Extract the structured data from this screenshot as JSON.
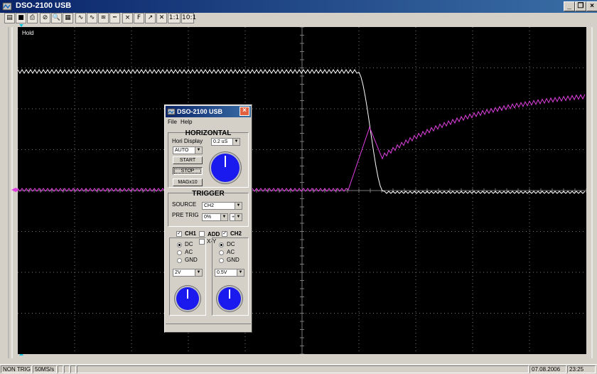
{
  "window": {
    "title": "DSO-2100 USB"
  },
  "toolbar": {
    "items": [
      {
        "name": "open-icon",
        "glyph": "▤"
      },
      {
        "name": "save-icon",
        "glyph": "■"
      },
      {
        "name": "print-icon",
        "glyph": "⎙"
      },
      {
        "name": "stop-sign-icon",
        "glyph": "⊘"
      },
      {
        "name": "zoom-icon",
        "glyph": "🔍"
      },
      {
        "name": "grid-icon",
        "glyph": "▦"
      },
      {
        "name": "sine-wave-icon",
        "glyph": "∿"
      },
      {
        "name": "wave-icon",
        "glyph": "∿"
      },
      {
        "name": "math-wave-icon",
        "glyph": "≋"
      },
      {
        "name": "dashed-lines-icon",
        "glyph": "┅"
      },
      {
        "name": "cursor-icon",
        "glyph": "×"
      },
      {
        "name": "fft-icon",
        "glyph": "F"
      },
      {
        "name": "measure-icon",
        "glyph": "↗"
      },
      {
        "name": "xy-icon",
        "glyph": "✕"
      },
      {
        "name": "ratio-1-1-icon",
        "glyph": "1:1"
      },
      {
        "name": "ratio-10-1-icon",
        "glyph": "10:1"
      }
    ]
  },
  "scope": {
    "hold_label": "Hold"
  },
  "statusbar": {
    "trigger_status": "NON TRIG",
    "sample_rate": "50MS/s",
    "date": "07.08.2006",
    "time": "23:25"
  },
  "panel": {
    "title": "DSO-2100 USB",
    "menu": [
      "File",
      "Help"
    ],
    "horizontal": {
      "title": "HORIZONTAL",
      "hori_display_label": "Hori Display",
      "timebase_value": "0.2 uS",
      "mode_value": "AUTO",
      "start_label": "START",
      "stop_label": "STOP",
      "mag_label": "MAGx10"
    },
    "trigger": {
      "title": "TRIGGER",
      "source_label": "SOURCE",
      "source_value": "CH2",
      "pretrig_label": "PRE TRIG",
      "pretrig_value": "0%",
      "slope_value": "+"
    },
    "channels": {
      "ch1_label": "CH1",
      "add_label": "ADD",
      "ch2_label": "CH2",
      "xy_label": "X-Y",
      "coupling": [
        "DC",
        "AC",
        "GND"
      ],
      "ch1_volts": "2V",
      "ch2_volts": "0.5V"
    }
  },
  "colors": {
    "ch1_trace": "#ffffff",
    "ch2_trace": "#e040e0",
    "screen": "#000000",
    "grid": "#7a7a7a"
  }
}
